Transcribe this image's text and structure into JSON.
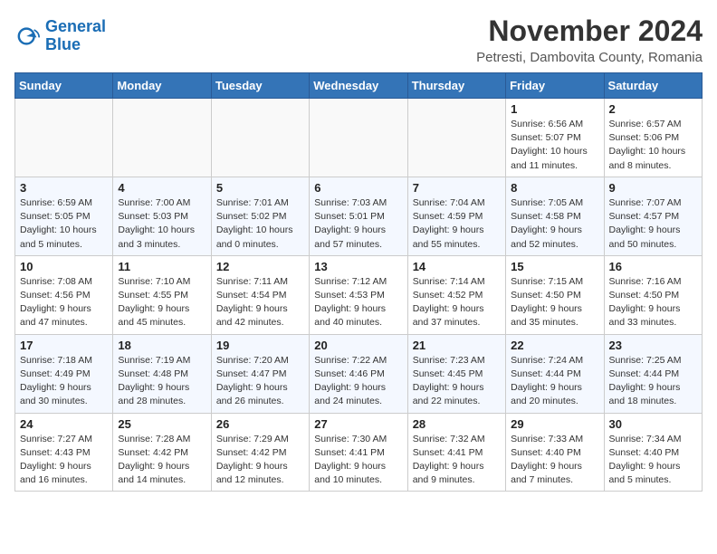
{
  "header": {
    "logo_line1": "General",
    "logo_line2": "Blue",
    "month_title": "November 2024",
    "location": "Petresti, Dambovita County, Romania"
  },
  "days_of_week": [
    "Sunday",
    "Monday",
    "Tuesday",
    "Wednesday",
    "Thursday",
    "Friday",
    "Saturday"
  ],
  "weeks": [
    [
      {
        "day": "",
        "detail": ""
      },
      {
        "day": "",
        "detail": ""
      },
      {
        "day": "",
        "detail": ""
      },
      {
        "day": "",
        "detail": ""
      },
      {
        "day": "",
        "detail": ""
      },
      {
        "day": "1",
        "detail": "Sunrise: 6:56 AM\nSunset: 5:07 PM\nDaylight: 10 hours and 11 minutes."
      },
      {
        "day": "2",
        "detail": "Sunrise: 6:57 AM\nSunset: 5:06 PM\nDaylight: 10 hours and 8 minutes."
      }
    ],
    [
      {
        "day": "3",
        "detail": "Sunrise: 6:59 AM\nSunset: 5:05 PM\nDaylight: 10 hours and 5 minutes."
      },
      {
        "day": "4",
        "detail": "Sunrise: 7:00 AM\nSunset: 5:03 PM\nDaylight: 10 hours and 3 minutes."
      },
      {
        "day": "5",
        "detail": "Sunrise: 7:01 AM\nSunset: 5:02 PM\nDaylight: 10 hours and 0 minutes."
      },
      {
        "day": "6",
        "detail": "Sunrise: 7:03 AM\nSunset: 5:01 PM\nDaylight: 9 hours and 57 minutes."
      },
      {
        "day": "7",
        "detail": "Sunrise: 7:04 AM\nSunset: 4:59 PM\nDaylight: 9 hours and 55 minutes."
      },
      {
        "day": "8",
        "detail": "Sunrise: 7:05 AM\nSunset: 4:58 PM\nDaylight: 9 hours and 52 minutes."
      },
      {
        "day": "9",
        "detail": "Sunrise: 7:07 AM\nSunset: 4:57 PM\nDaylight: 9 hours and 50 minutes."
      }
    ],
    [
      {
        "day": "10",
        "detail": "Sunrise: 7:08 AM\nSunset: 4:56 PM\nDaylight: 9 hours and 47 minutes."
      },
      {
        "day": "11",
        "detail": "Sunrise: 7:10 AM\nSunset: 4:55 PM\nDaylight: 9 hours and 45 minutes."
      },
      {
        "day": "12",
        "detail": "Sunrise: 7:11 AM\nSunset: 4:54 PM\nDaylight: 9 hours and 42 minutes."
      },
      {
        "day": "13",
        "detail": "Sunrise: 7:12 AM\nSunset: 4:53 PM\nDaylight: 9 hours and 40 minutes."
      },
      {
        "day": "14",
        "detail": "Sunrise: 7:14 AM\nSunset: 4:52 PM\nDaylight: 9 hours and 37 minutes."
      },
      {
        "day": "15",
        "detail": "Sunrise: 7:15 AM\nSunset: 4:50 PM\nDaylight: 9 hours and 35 minutes."
      },
      {
        "day": "16",
        "detail": "Sunrise: 7:16 AM\nSunset: 4:50 PM\nDaylight: 9 hours and 33 minutes."
      }
    ],
    [
      {
        "day": "17",
        "detail": "Sunrise: 7:18 AM\nSunset: 4:49 PM\nDaylight: 9 hours and 30 minutes."
      },
      {
        "day": "18",
        "detail": "Sunrise: 7:19 AM\nSunset: 4:48 PM\nDaylight: 9 hours and 28 minutes."
      },
      {
        "day": "19",
        "detail": "Sunrise: 7:20 AM\nSunset: 4:47 PM\nDaylight: 9 hours and 26 minutes."
      },
      {
        "day": "20",
        "detail": "Sunrise: 7:22 AM\nSunset: 4:46 PM\nDaylight: 9 hours and 24 minutes."
      },
      {
        "day": "21",
        "detail": "Sunrise: 7:23 AM\nSunset: 4:45 PM\nDaylight: 9 hours and 22 minutes."
      },
      {
        "day": "22",
        "detail": "Sunrise: 7:24 AM\nSunset: 4:44 PM\nDaylight: 9 hours and 20 minutes."
      },
      {
        "day": "23",
        "detail": "Sunrise: 7:25 AM\nSunset: 4:44 PM\nDaylight: 9 hours and 18 minutes."
      }
    ],
    [
      {
        "day": "24",
        "detail": "Sunrise: 7:27 AM\nSunset: 4:43 PM\nDaylight: 9 hours and 16 minutes."
      },
      {
        "day": "25",
        "detail": "Sunrise: 7:28 AM\nSunset: 4:42 PM\nDaylight: 9 hours and 14 minutes."
      },
      {
        "day": "26",
        "detail": "Sunrise: 7:29 AM\nSunset: 4:42 PM\nDaylight: 9 hours and 12 minutes."
      },
      {
        "day": "27",
        "detail": "Sunrise: 7:30 AM\nSunset: 4:41 PM\nDaylight: 9 hours and 10 minutes."
      },
      {
        "day": "28",
        "detail": "Sunrise: 7:32 AM\nSunset: 4:41 PM\nDaylight: 9 hours and 9 minutes."
      },
      {
        "day": "29",
        "detail": "Sunrise: 7:33 AM\nSunset: 4:40 PM\nDaylight: 9 hours and 7 minutes."
      },
      {
        "day": "30",
        "detail": "Sunrise: 7:34 AM\nSunset: 4:40 PM\nDaylight: 9 hours and 5 minutes."
      }
    ]
  ]
}
